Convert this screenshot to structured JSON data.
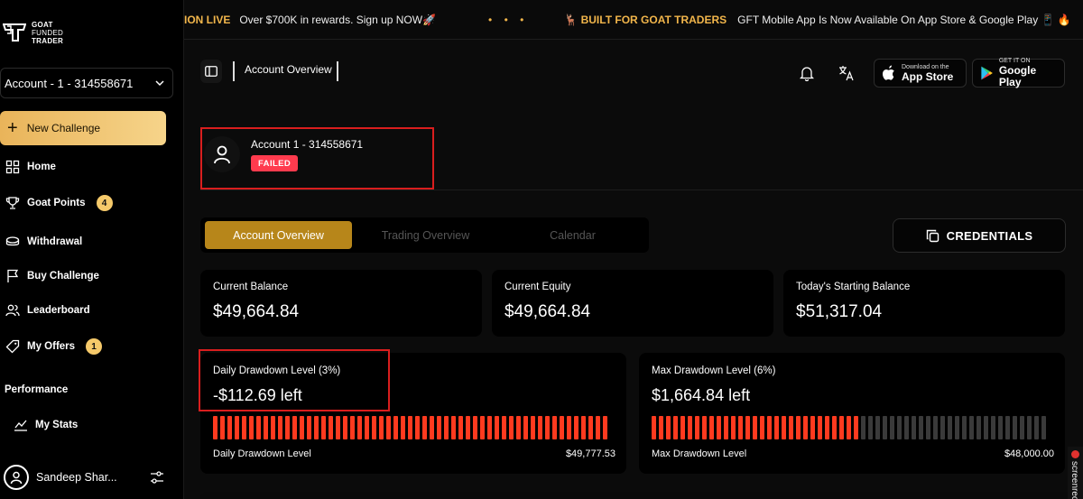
{
  "brand": {
    "line1": "GOAT",
    "line2": "FUNDED",
    "line3": "TRADER"
  },
  "sidebar": {
    "account_select": "Account - 1 - 314558671",
    "new_challenge": "New Challenge",
    "items": [
      {
        "label": "Home",
        "icon": "grid-icon"
      },
      {
        "label": "Goat Points",
        "icon": "trophy-icon",
        "badge": "4"
      },
      {
        "label": "Withdrawal",
        "icon": "cash-icon"
      },
      {
        "label": "Buy Challenge",
        "icon": "flag-icon"
      },
      {
        "label": "Leaderboard",
        "icon": "users-icon"
      },
      {
        "label": "My Offers",
        "icon": "tag-icon",
        "badge": "1"
      }
    ],
    "section_performance": "Performance",
    "my_stats": "My Stats",
    "user_name": "Sandeep Shar..."
  },
  "marquee": {
    "live": "ION LIVE",
    "text1": "Over $700K in rewards. Sign up NOW🚀",
    "dots": "• • •",
    "built": "🦌 BUILT FOR GOAT TRADERS",
    "text2": "GFT Mobile App Is Now Available On App Store & Google Play 📱 🔥"
  },
  "header": {
    "breadcrumb": "Account Overview",
    "appstore_small": "Download on the",
    "appstore_big": "App Store",
    "googleplay_small": "GET IT ON",
    "googleplay_big": "Google Play"
  },
  "account": {
    "name": "Account 1 - 314558671",
    "status": "FAILED"
  },
  "tabs": [
    {
      "label": "Account Overview",
      "active": true
    },
    {
      "label": "Trading Overview",
      "active": false
    },
    {
      "label": "Calendar",
      "active": false
    }
  ],
  "credentials_label": "CREDENTIALS",
  "stats": [
    {
      "label": "Current Balance",
      "value": "$49,664.84"
    },
    {
      "label": "Current Equity",
      "value": "$49,664.84"
    },
    {
      "label": "Today's Starting Balance",
      "value": "$51,317.04"
    }
  ],
  "drawdowns": [
    {
      "label": "Daily Drawdown Level (3%)",
      "value": "-$112.69 left",
      "footer_label": "Daily Drawdown Level",
      "footer_value": "$49,777.53",
      "filled_fraction": 1.0
    },
    {
      "label": "Max Drawdown Level (6%)",
      "value": "$1,664.84 left",
      "footer_label": "Max Drawdown Level",
      "footer_value": "$48,000.00",
      "filled_fraction": 0.52
    }
  ],
  "colors": {
    "accent": "#b7861a",
    "bar_red": "#ff3a1f",
    "bar_gray": "#3a3a3a",
    "failed": "#ff3b4e",
    "highlight": "#d91e1e"
  },
  "recorder": "screenrec"
}
